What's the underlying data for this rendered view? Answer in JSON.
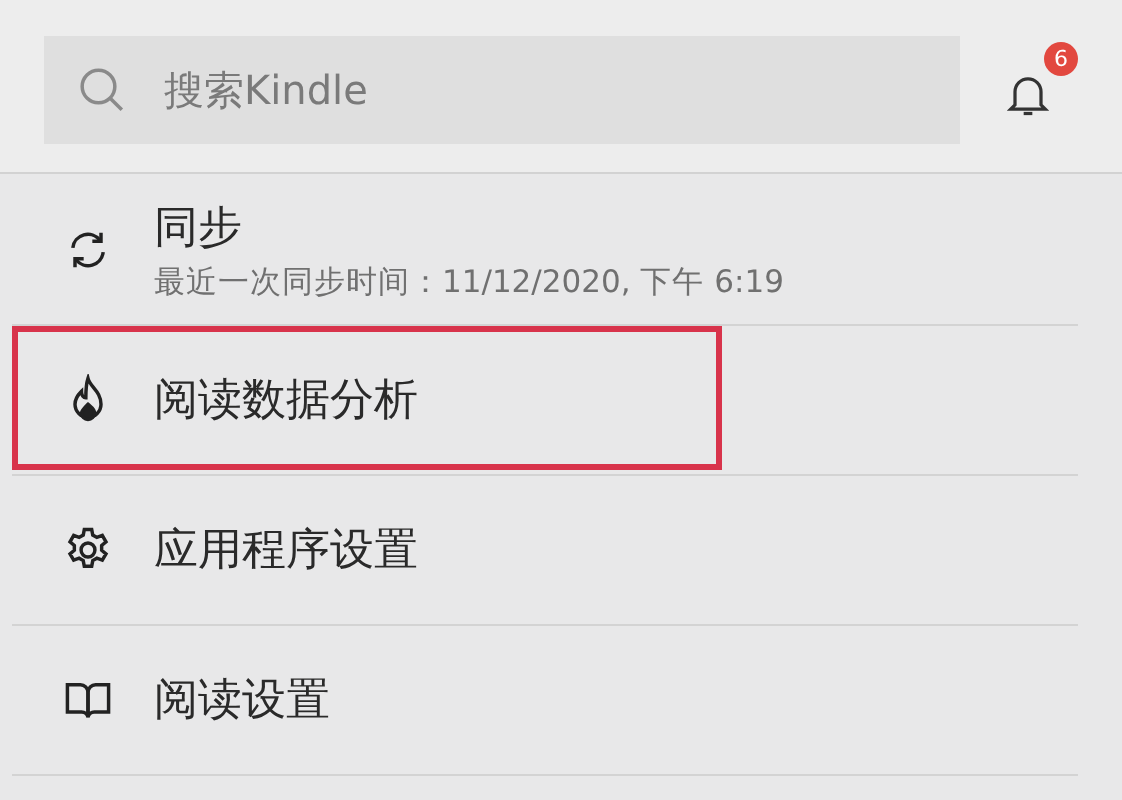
{
  "search": {
    "placeholder": "搜索Kindle"
  },
  "notifications": {
    "badge": "6"
  },
  "menu": [
    {
      "kind": "sync",
      "title": "同步",
      "subtitle": "最近一次同步时间：11/12/2020, 下午 6:19",
      "highlighted": false
    },
    {
      "kind": "stats",
      "title": "阅读数据分析",
      "highlighted": true
    },
    {
      "kind": "settings",
      "title": "应用程序设置",
      "highlighted": false
    },
    {
      "kind": "reading",
      "title": "阅读设置",
      "highlighted": false
    }
  ]
}
